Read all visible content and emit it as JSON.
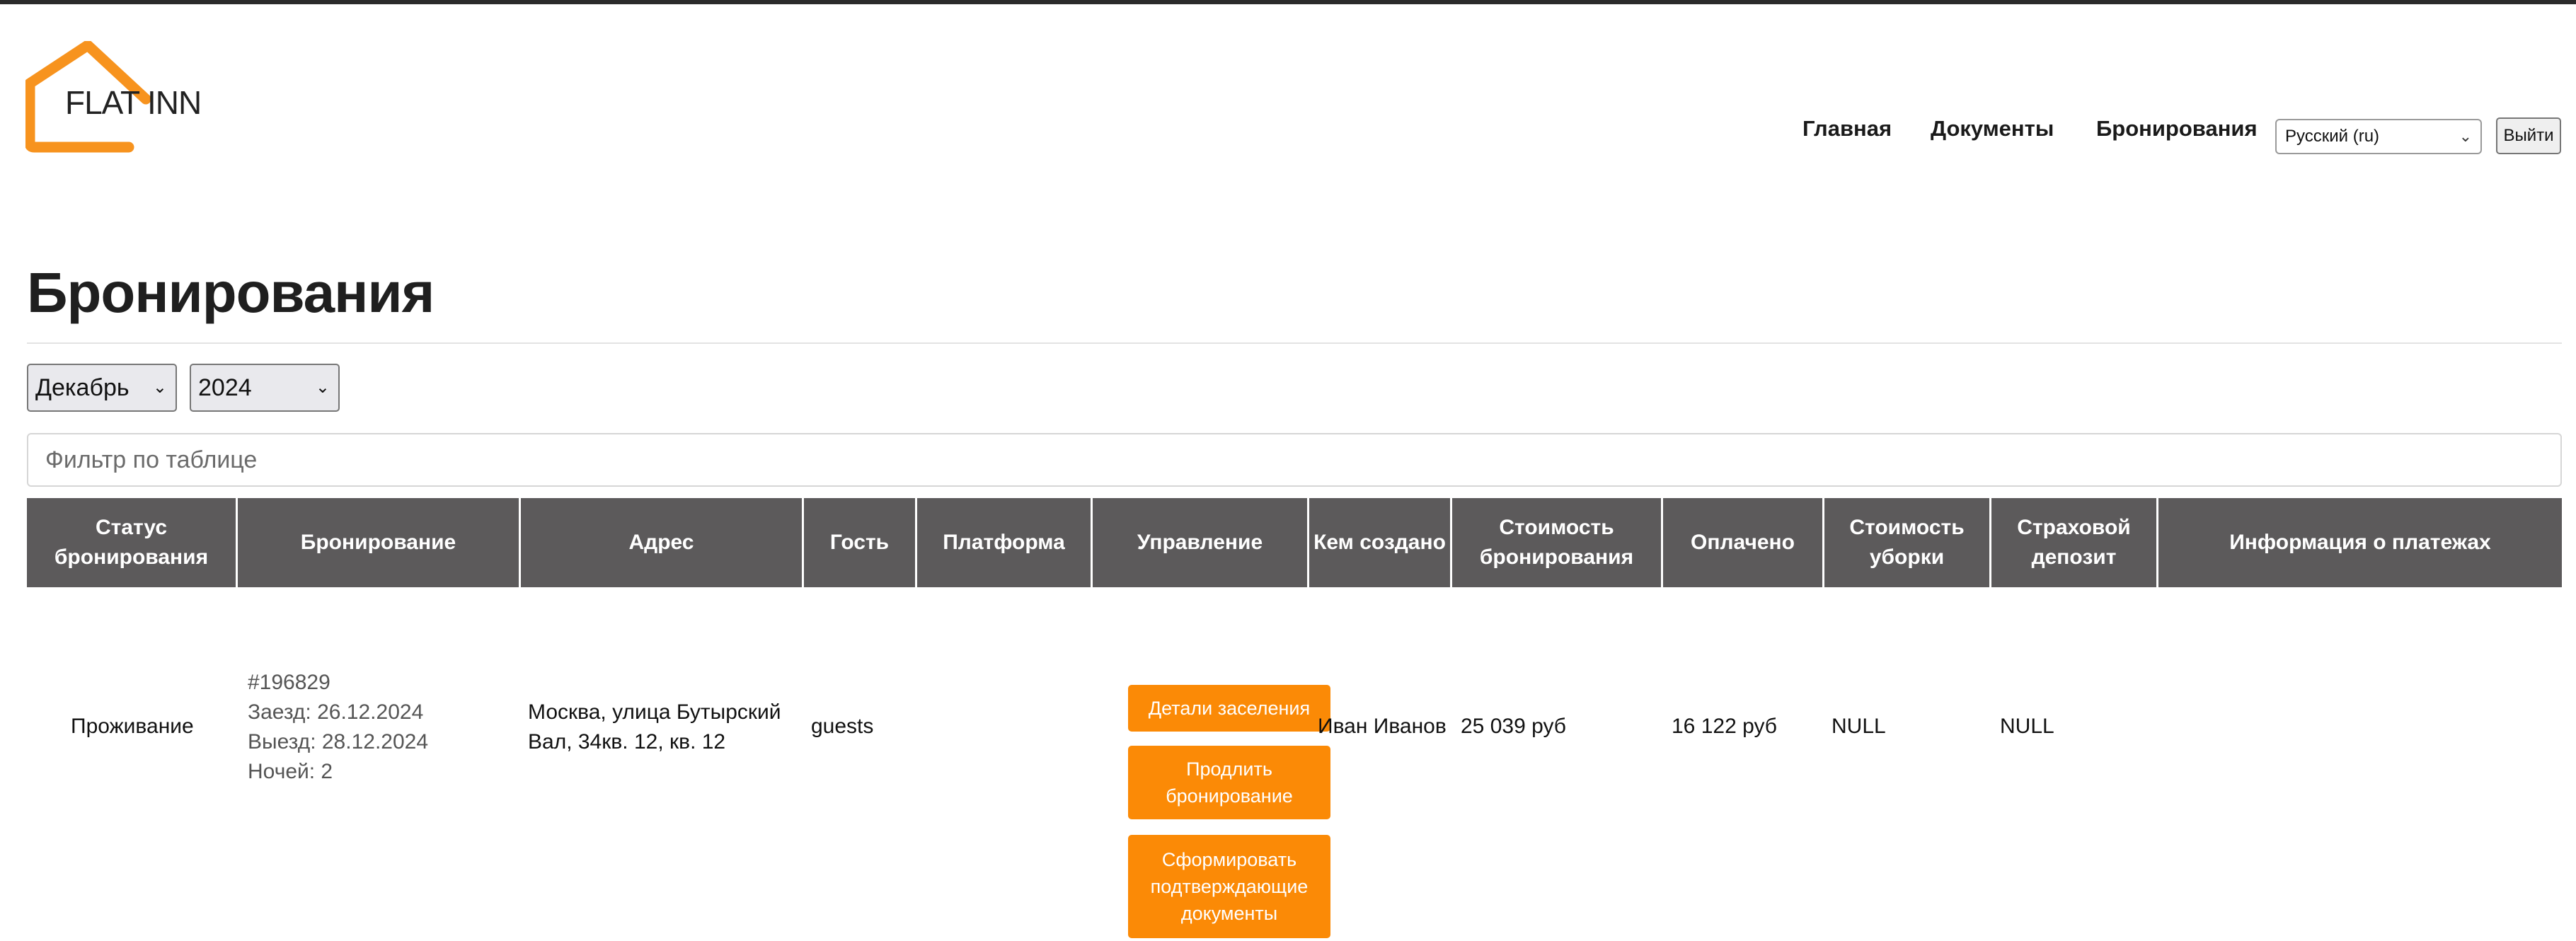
{
  "header": {
    "logo_text": "FLAT INN",
    "brand_color": "#f7931e",
    "nav": [
      "Главная",
      "Документы",
      "Бронирования"
    ],
    "language_select": "Русский (ru)",
    "logout": "Выйти"
  },
  "page": {
    "title": "Бронирования"
  },
  "filters": {
    "month": "Декабрь",
    "year": "2024",
    "table_filter_placeholder": "Фильтр по таблице"
  },
  "table": {
    "header_color": "#5c5a5b",
    "columns": [
      "Статус бронирования",
      "Бронирование",
      "Адрес",
      "Гость",
      "Платформа",
      "Управление",
      "Кем создано",
      "Стоимость бронирования",
      "Оплачено",
      "Стоимость уборки",
      "Страховой депозит",
      "Информация о платежах"
    ],
    "rows": [
      {
        "status": "Проживание",
        "booking_id": "#196829",
        "check_in": "Заезд: 26.12.2024",
        "check_out": "Выезд: 28.12.2024",
        "nights": "Ночей: 2",
        "address": "Москва, улица Бутырский Вал, 34кв. 12, кв. 12",
        "guest": "guests",
        "platform": "",
        "actions": {
          "details": "Детали заселения",
          "extend": "Продлить бронирование",
          "generate_docs": "Сформировать подтверждающие документы"
        },
        "created_by": "Иван Иванов",
        "booking_cost": "25 039 руб",
        "paid": "16 122 руб",
        "cleaning_cost": "NULL",
        "deposit": "NULL",
        "payment_info": ""
      }
    ],
    "action_color": "#fb8a06"
  }
}
